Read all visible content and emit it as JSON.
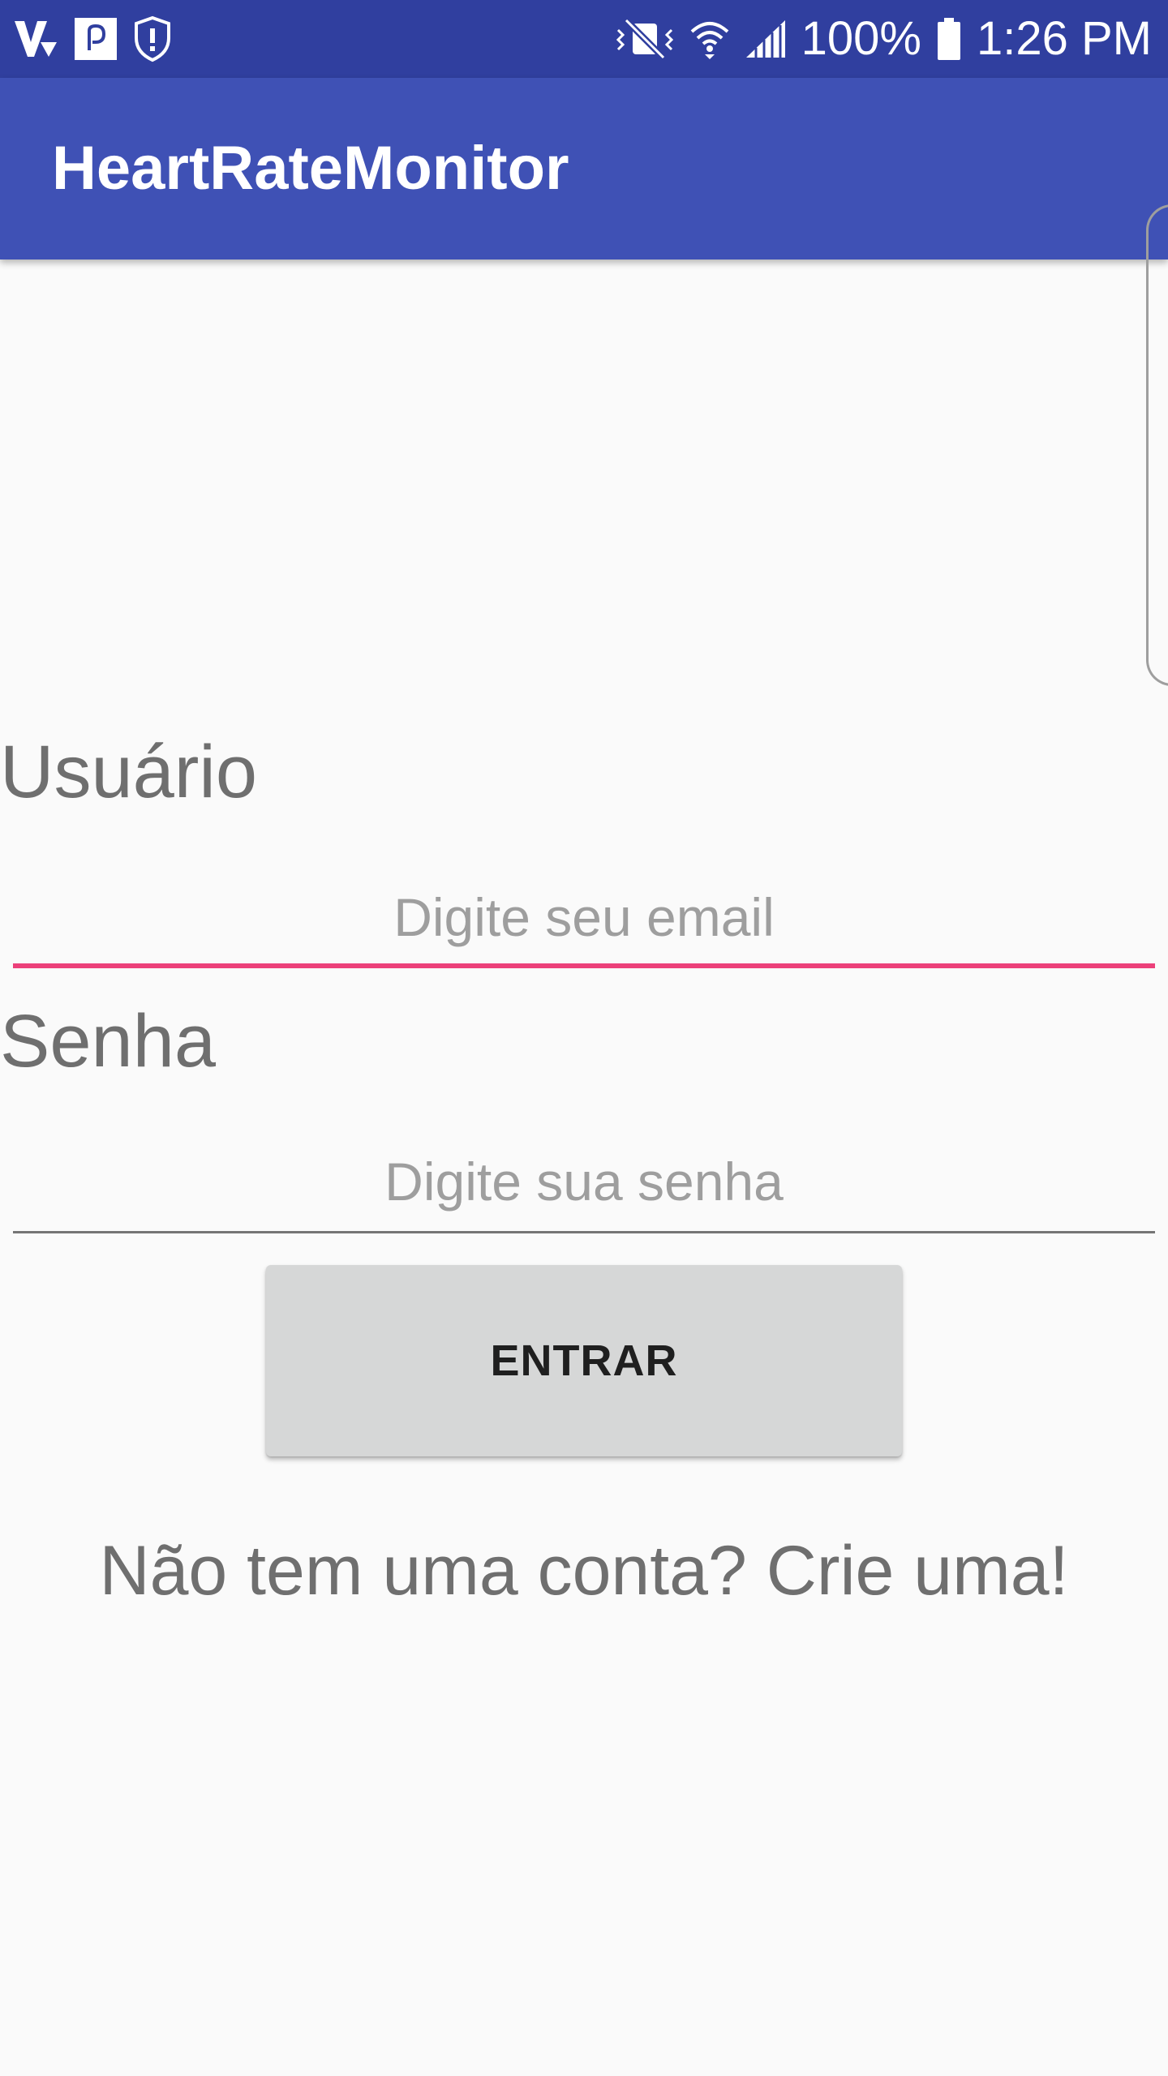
{
  "status_bar": {
    "battery": "100%",
    "time": "1:26 PM",
    "left_icons": [
      "vpn-key-icon",
      "pocket-app-icon",
      "security-shield-icon"
    ],
    "right_icons": [
      "vibrate-mute-icon",
      "wifi-icon",
      "signal-icon",
      "battery-icon"
    ]
  },
  "app_bar": {
    "title": "HeartRateMonitor"
  },
  "form": {
    "user_label": "Usuário",
    "email_placeholder": "Digite seu email",
    "password_label": "Senha",
    "password_placeholder": "Digite sua senha",
    "submit_label": "ENTRAR",
    "signup_text": "Não tem uma conta? Crie uma!"
  },
  "colors": {
    "status_bar": "#303f9f",
    "app_bar": "#3f51b5",
    "accent": "#ec407a",
    "background": "#fafafa",
    "button": "#d6d7d7"
  }
}
